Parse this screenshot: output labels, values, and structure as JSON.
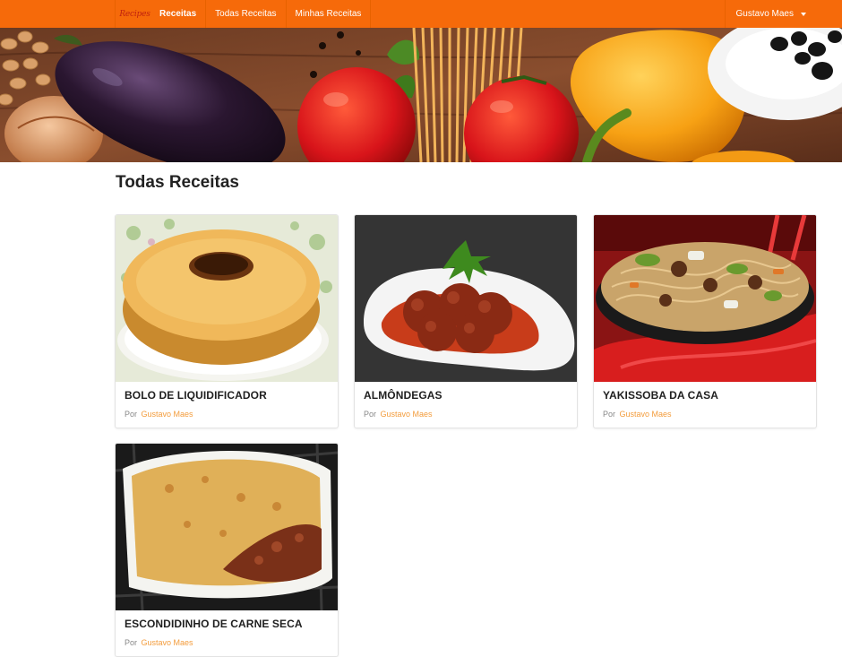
{
  "brand": {
    "logo_text": "Recipes"
  },
  "nav": {
    "items": [
      {
        "label": "Receitas",
        "active": true
      },
      {
        "label": "Todas Receitas",
        "active": false
      },
      {
        "label": "Minhas Receitas",
        "active": false
      }
    ],
    "user": {
      "name": "Gustavo Maes",
      "icon": "caret-down-icon"
    }
  },
  "page": {
    "title": "Todas Receitas"
  },
  "recipes": [
    {
      "title": "BOLO DE LIQUIDIFICADOR",
      "by_label": "Por",
      "author": "Gustavo Maes",
      "image": "cake-photo"
    },
    {
      "title": "ALMÔNDEGAS",
      "by_label": "Por",
      "author": "Gustavo Maes",
      "image": "meatballs-photo"
    },
    {
      "title": "YAKISSOBA DA CASA",
      "by_label": "Por",
      "author": "Gustavo Maes",
      "image": "yakisoba-photo"
    },
    {
      "title": "ESCONDIDINHO DE CARNE SECA",
      "by_label": "Por",
      "author": "Gustavo Maes",
      "image": "casserole-photo"
    }
  ],
  "colors": {
    "navbar": "#f66a0a",
    "author_link": "#f39c3c",
    "brand_logo": "#c0220f"
  }
}
